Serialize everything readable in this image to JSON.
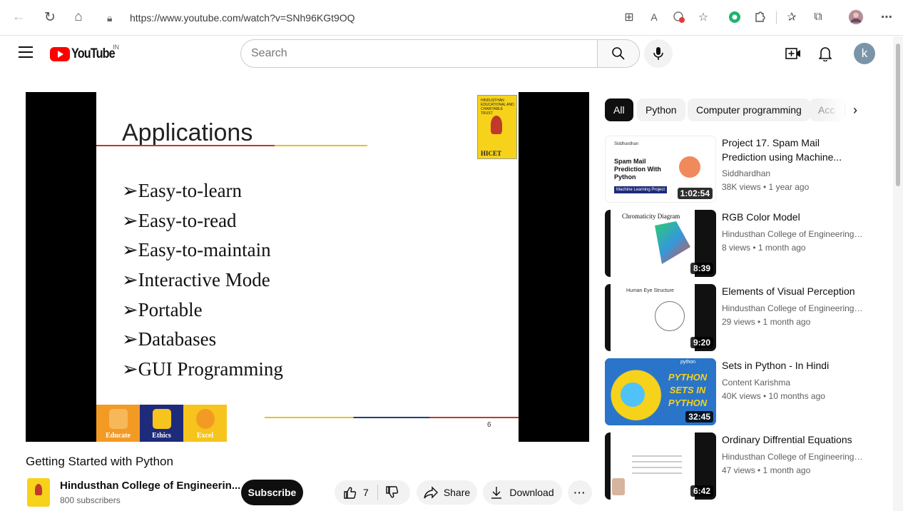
{
  "browser": {
    "url": "https://www.youtube.com/watch?v=SNh96KGt9OQ",
    "icons": [
      "back-icon",
      "refresh-icon",
      "home-icon",
      "lock-icon",
      "apps-icon",
      "read-aloud-icon",
      "tracking-icon",
      "favorite-icon",
      "extension-icon",
      "puzzle-icon",
      "favorites-icon",
      "collections-icon",
      "profile-icon",
      "more-icon"
    ]
  },
  "header": {
    "logo_text": "YouTube",
    "region": "IN",
    "search_placeholder": "Search",
    "avatar_letter": "k"
  },
  "video": {
    "slide": {
      "title": "Applications",
      "items": [
        "➢Easy-to-learn",
        "➢Easy-to-read",
        "➢Easy-to-maintain",
        "➢Interactive Mode",
        "➢Portable",
        "➢Databases",
        "➢GUI Programming"
      ],
      "logo_header": "HINDUSTHAN EDUCATIONAL AND CHARITABLE TRUST",
      "logo_text": "HICET",
      "footer": [
        "Educate",
        "Ethics",
        "Excel"
      ],
      "footer_colors": [
        "#f39a24",
        "#1e2b7a",
        "#f6c41c"
      ],
      "page_number": "6"
    },
    "title": "Getting Started with Python",
    "channel": "Hindusthan College of Engineerin...",
    "subscribers": "800 subscribers",
    "subscribe_label": "Subscribe",
    "likes": "7",
    "share_label": "Share",
    "download_label": "Download"
  },
  "chips": [
    "All",
    "Python",
    "Computer programming",
    "Acc"
  ],
  "recommendations": [
    {
      "title": "Project 17. Spam Mail Prediction using Machine...",
      "channel": "Siddhardhan",
      "meta": "38K views • 1 year ago",
      "duration": "1:02:54",
      "thumb_header": "Siddhardhan",
      "thumb_text": "Spam Mail Prediction With Python",
      "thumb_tag": "Machine Learning Project"
    },
    {
      "title": "RGB Color Model",
      "channel": "Hindusthan College of Engineering a...",
      "meta": "8 views • 1 month ago",
      "duration": "8:39",
      "thumb_text": "Chromaticity Diagram"
    },
    {
      "title": "Elements of Visual Perception",
      "channel": "Hindusthan College of Engineering a...",
      "meta": "29 views • 1 month ago",
      "duration": "9:20",
      "thumb_text": "Human Eye Structure"
    },
    {
      "title": "Sets in Python - In Hindi",
      "channel": "Content Karishma",
      "meta": "40K views • 10 months ago",
      "duration": "32:45",
      "thumb_header": "python",
      "thumb_text": "PYTHON SETS IN PYTHON"
    },
    {
      "title": "Ordinary Diffrential Equations",
      "channel": "Hindusthan College of Engineering a...",
      "meta": "47 views • 1 month ago",
      "duration": "6:42"
    }
  ]
}
